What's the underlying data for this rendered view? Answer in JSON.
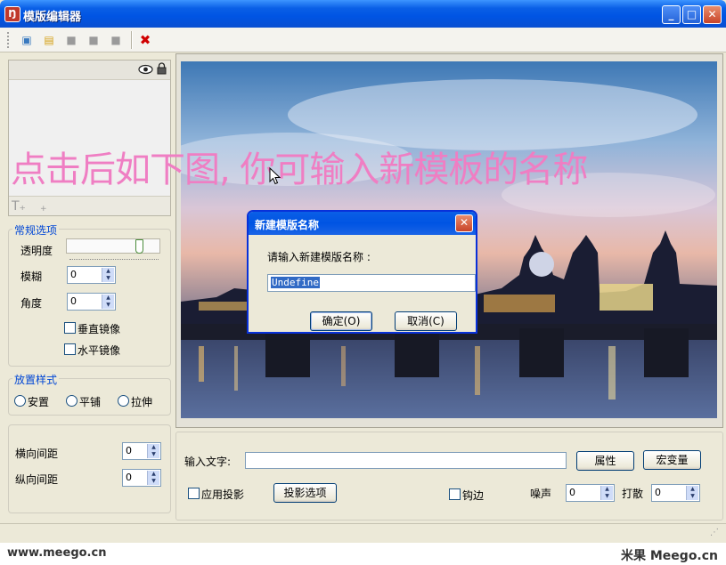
{
  "window": {
    "title": "模版编辑器",
    "app_icon": "app-logo-icon",
    "min_glyph": "_",
    "max_glyph": "□",
    "close_glyph": "✕"
  },
  "toolbar": {
    "items": [
      {
        "name": "new-template-icon",
        "glyph": "▣",
        "color": "#3a7abf"
      },
      {
        "name": "open-folder-icon",
        "glyph": "▤",
        "color": "#d4a017"
      },
      {
        "name": "save-icon",
        "glyph": "■",
        "color": "#9a9a9a"
      },
      {
        "name": "copy-icon",
        "glyph": "■",
        "color": "#9a9a9a"
      },
      {
        "name": "properties-icon",
        "glyph": "■",
        "color": "#9a9a9a"
      },
      {
        "name": "delete-icon",
        "glyph": "✖",
        "color": "#d00000"
      }
    ]
  },
  "layers": {
    "eye_icon": "eye-icon",
    "lock_icon": "lock-icon",
    "add_text_glyph": "T₊",
    "add_glyph": "+"
  },
  "general": {
    "title": "常规选项",
    "opacity_label": "透明度",
    "opacity_value": 0.78,
    "blur_label": "模糊",
    "blur_value": "0",
    "angle_label": "角度",
    "angle_value": "0",
    "flip_v_label": "垂直镜像",
    "flip_h_label": "水平镜像"
  },
  "placement": {
    "title": "放置样式",
    "options": [
      "安置",
      "平铺",
      "拉伸"
    ]
  },
  "spacing": {
    "h_label": "横向间距",
    "h_value": "0",
    "v_label": "纵向间距",
    "v_value": "0"
  },
  "annotation": "点击后如下图, 你可输入新模板的名称",
  "dialog": {
    "title": "新建模版名称",
    "prompt": "请输入新建模版名称 :",
    "input_value": "Undefine",
    "ok_label": "确定(O)",
    "cancel_label": "取消(C)",
    "close_glyph": "✕"
  },
  "text_panel": {
    "input_label": "输入文字:",
    "input_value": "",
    "props_button": "属性",
    "macro_button": "宏变量",
    "shadow_label": "应用投影",
    "shadow_options_button": "投影选项",
    "stroke_label": "钩边",
    "noise_label": "噪声",
    "noise_value": "0",
    "scatter_label": "打散",
    "scatter_value": "0"
  },
  "footer": {
    "left": "www.meego.cn",
    "right": "米果 Meego.cn"
  }
}
